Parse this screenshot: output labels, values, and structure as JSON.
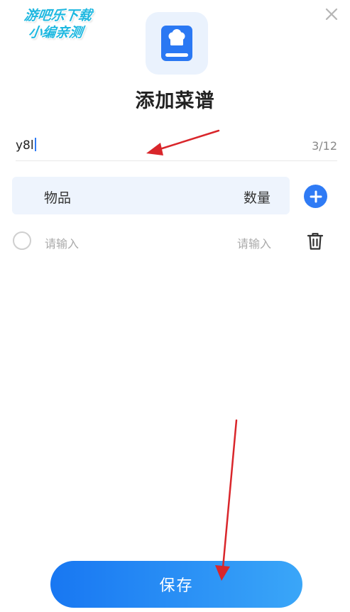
{
  "watermark": {
    "line1": "游吧乐下载",
    "line2": "小编亲测"
  },
  "dialog": {
    "title": "添加菜谱",
    "close_icon": "close-icon",
    "app_icon": "recipe-book-icon"
  },
  "recipe_name": {
    "value": "y8l",
    "counter": "3/12"
  },
  "table": {
    "header_item": "物品",
    "header_qty": "数量",
    "add_icon": "plus-circle-icon",
    "rows": [
      {
        "name_placeholder": "请输入",
        "qty_placeholder": "请输入",
        "delete_icon": "trash-icon"
      }
    ]
  },
  "save_label": "保存",
  "colors": {
    "accent": "#2f7bf5",
    "header_bg": "#eef4fd",
    "annotation_arrow": "#d9262b"
  }
}
